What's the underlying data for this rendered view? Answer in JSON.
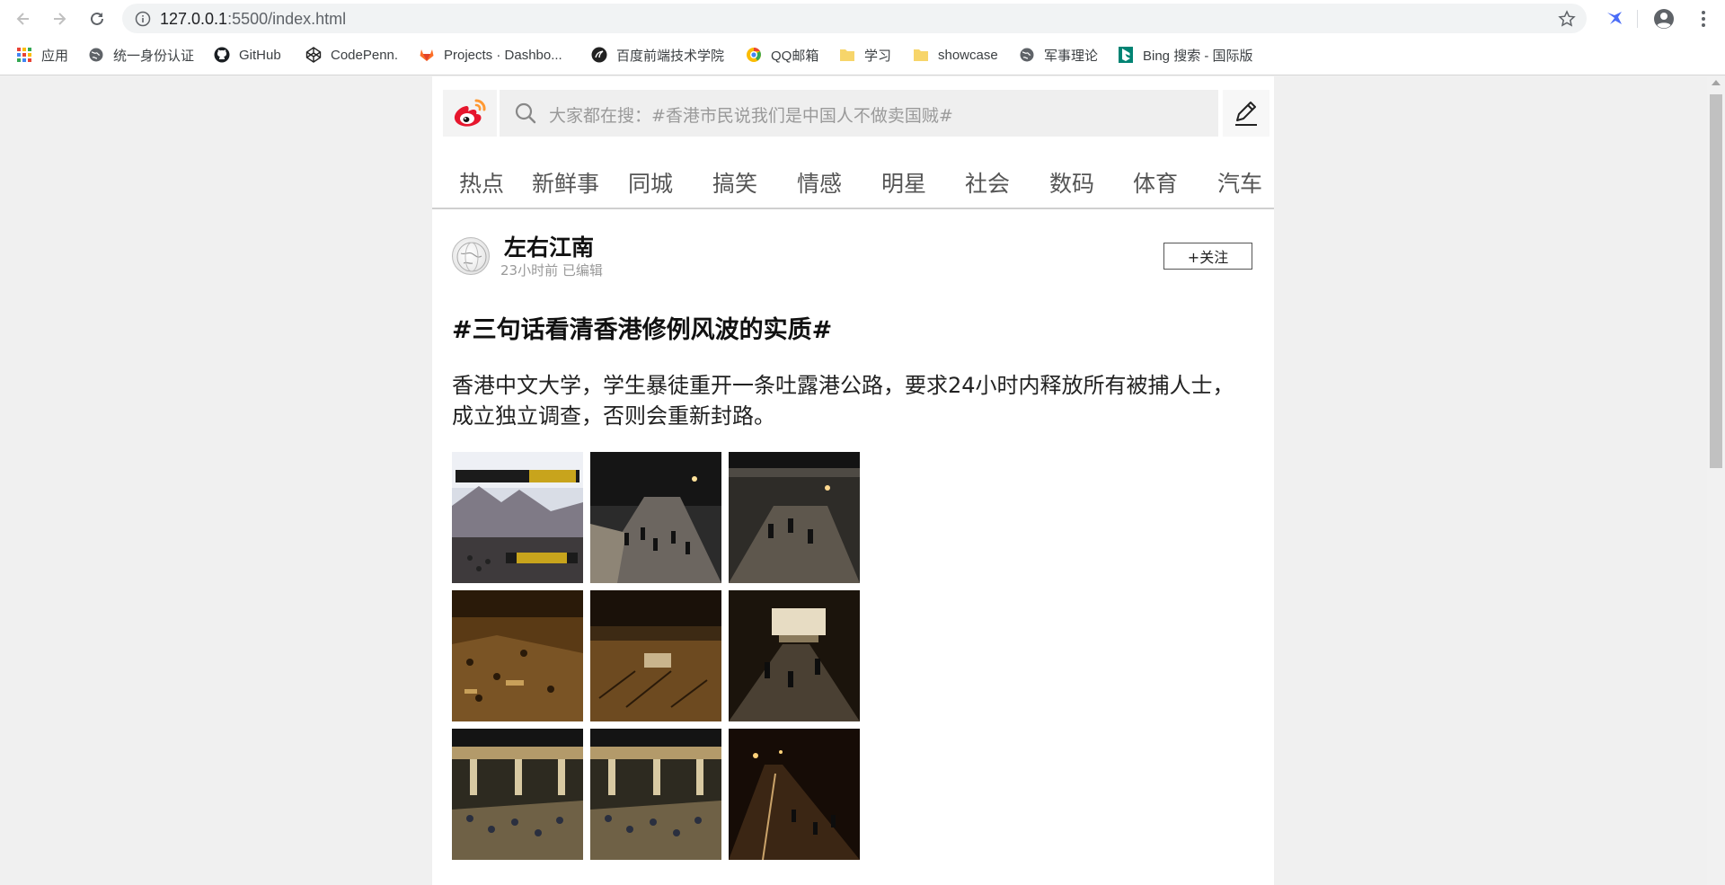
{
  "browser": {
    "url_host": "127.0.0.1",
    "url_path": ":5500/index.html"
  },
  "bookmarks": [
    {
      "label": "应用",
      "icon": "apps-grid-icon"
    },
    {
      "label": "统一身份认证",
      "icon": "globe-icon"
    },
    {
      "label": "GitHub",
      "icon": "github-icon"
    },
    {
      "label": "CodePenn.",
      "icon": "codepen-icon"
    },
    {
      "label": "Projects · Dashbo...",
      "icon": "gitlab-icon"
    },
    {
      "label": "百度前端技术学院",
      "icon": "baidu-ife-icon"
    },
    {
      "label": "QQ邮箱",
      "icon": "qq-mail-icon"
    },
    {
      "label": "学习",
      "icon": "folder-icon"
    },
    {
      "label": "showcase",
      "icon": "folder-icon"
    },
    {
      "label": "军事理论",
      "icon": "globe-icon"
    },
    {
      "label": "Bing 搜索 - 国际版",
      "icon": "bing-icon"
    }
  ],
  "header": {
    "search_placeholder": "大家都在搜：#香港市民说我们是中国人不做卖国贼#"
  },
  "tabs": [
    "热点",
    "新鲜事",
    "同城",
    "搞笑",
    "情感",
    "明星",
    "社会",
    "数码",
    "体育",
    "汽车"
  ],
  "post": {
    "author_name": "左右江南",
    "meta": "23小时前 已编辑",
    "follow_label": "+关注",
    "headline": "#三句话看清香港修例风波的实质#",
    "body": "香港中文大学，学生暴徒重开一条吐露港公路，要求24小时内释放所有被捕人士，成立独立调查，否则会重新封路。",
    "photo_count": 9
  },
  "colors": {
    "weibo_red": "#e6162d",
    "weibo_orange": "#ff9933",
    "page_bg": "#f0f0f0"
  }
}
